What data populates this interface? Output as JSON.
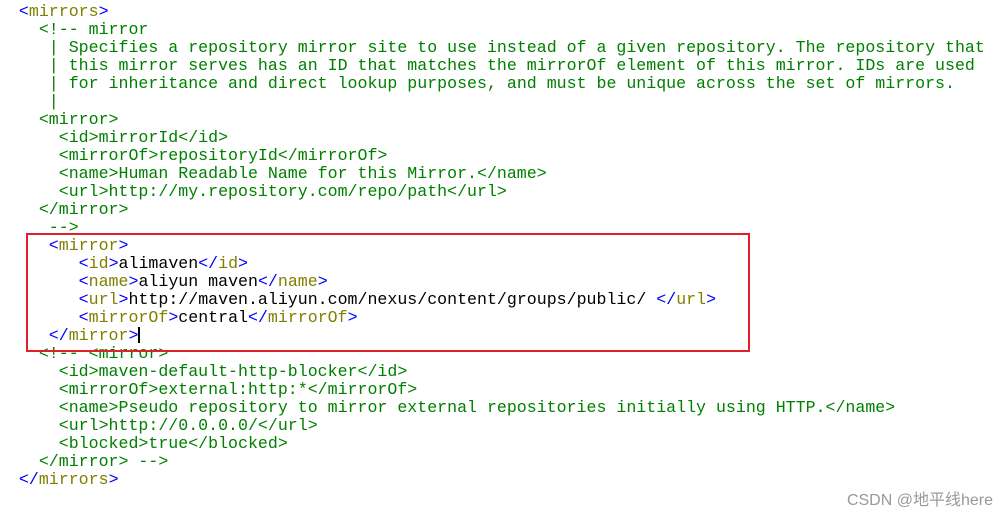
{
  "colors": {
    "bracket": "#0000ff",
    "tag": "#808000",
    "text": "#000000",
    "comment": "#008000",
    "highlight_box": "#e0202a"
  },
  "lines": [
    {
      "indent": 2,
      "segs": [
        [
          "b",
          "<"
        ],
        [
          "t",
          "mirrors"
        ],
        [
          "b",
          ">"
        ]
      ]
    },
    {
      "indent": 4,
      "segs": [
        [
          "c",
          "<!-- mirror"
        ]
      ]
    },
    {
      "indent": 5,
      "segs": [
        [
          "c",
          "| Specifies a repository mirror site to use instead of a given repository. The repository that"
        ]
      ]
    },
    {
      "indent": 5,
      "segs": [
        [
          "c",
          "| this mirror serves has an ID that matches the mirrorOf element of this mirror. IDs are used"
        ]
      ]
    },
    {
      "indent": 5,
      "segs": [
        [
          "c",
          "| for inheritance and direct lookup purposes, and must be unique across the set of mirrors."
        ]
      ]
    },
    {
      "indent": 5,
      "segs": [
        [
          "c",
          "|"
        ]
      ]
    },
    {
      "indent": 4,
      "segs": [
        [
          "c",
          "<mirror>"
        ]
      ]
    },
    {
      "indent": 6,
      "segs": [
        [
          "c",
          "<id>mirrorId</id>"
        ]
      ]
    },
    {
      "indent": 6,
      "segs": [
        [
          "c",
          "<mirrorOf>repositoryId</mirrorOf>"
        ]
      ]
    },
    {
      "indent": 6,
      "segs": [
        [
          "c",
          "<name>Human Readable Name for this Mirror.</name>"
        ]
      ]
    },
    {
      "indent": 6,
      "segs": [
        [
          "c",
          "<url>http://my.repository.com/repo/path</url>"
        ]
      ]
    },
    {
      "indent": 4,
      "segs": [
        [
          "c",
          "</mirror>"
        ]
      ]
    },
    {
      "indent": 5,
      "segs": [
        [
          "c",
          "-->"
        ]
      ]
    },
    {
      "indent": 5,
      "segs": [
        [
          "b",
          "<"
        ],
        [
          "t",
          "mirror"
        ],
        [
          "b",
          ">"
        ]
      ]
    },
    {
      "indent": 8,
      "segs": [
        [
          "b",
          "<"
        ],
        [
          "t",
          "id"
        ],
        [
          "b",
          ">"
        ],
        [
          "x",
          "alimaven"
        ],
        [
          "b",
          "</"
        ],
        [
          "t",
          "id"
        ],
        [
          "b",
          ">"
        ]
      ]
    },
    {
      "indent": 8,
      "segs": [
        [
          "b",
          "<"
        ],
        [
          "t",
          "name"
        ],
        [
          "b",
          ">"
        ],
        [
          "x",
          "aliyun maven"
        ],
        [
          "b",
          "</"
        ],
        [
          "t",
          "name"
        ],
        [
          "b",
          ">"
        ]
      ]
    },
    {
      "indent": 8,
      "segs": [
        [
          "b",
          "<"
        ],
        [
          "t",
          "url"
        ],
        [
          "b",
          ">"
        ],
        [
          "x",
          "http://maven.aliyun.com/nexus/content/groups/public/ "
        ],
        [
          "b",
          "</"
        ],
        [
          "t",
          "url"
        ],
        [
          "b",
          ">"
        ]
      ]
    },
    {
      "indent": 8,
      "segs": [
        [
          "b",
          "<"
        ],
        [
          "t",
          "mirrorOf"
        ],
        [
          "b",
          ">"
        ],
        [
          "x",
          "central"
        ],
        [
          "b",
          "</"
        ],
        [
          "t",
          "mirrorOf"
        ],
        [
          "b",
          ">"
        ]
      ]
    },
    {
      "indent": 5,
      "segs": [
        [
          "b",
          "</"
        ],
        [
          "t",
          "mirror"
        ],
        [
          "b",
          ">"
        ]
      ],
      "cursor": true
    },
    {
      "indent": 4,
      "segs": [
        [
          "c",
          "<!-- <mirror>"
        ]
      ]
    },
    {
      "indent": 6,
      "segs": [
        [
          "c",
          "<id>maven-default-http-blocker</id>"
        ]
      ]
    },
    {
      "indent": 6,
      "segs": [
        [
          "c",
          "<mirrorOf>external:http:*</mirrorOf>"
        ]
      ]
    },
    {
      "indent": 6,
      "segs": [
        [
          "c",
          "<name>Pseudo repository to mirror external repositories initially using HTTP.</name>"
        ]
      ]
    },
    {
      "indent": 6,
      "segs": [
        [
          "c",
          "<url>http://0.0.0.0/</url>"
        ]
      ]
    },
    {
      "indent": 6,
      "segs": [
        [
          "c",
          "<blocked>true</blocked>"
        ]
      ]
    },
    {
      "indent": 4,
      "segs": [
        [
          "c",
          "</mirror> -->"
        ]
      ]
    },
    {
      "indent": 2,
      "segs": [
        [
          "b",
          "</"
        ],
        [
          "t",
          "mirrors"
        ],
        [
          "b",
          ">"
        ]
      ]
    },
    {
      "indent": 0,
      "segs": []
    }
  ],
  "watermark": "CSDN @地平线here"
}
